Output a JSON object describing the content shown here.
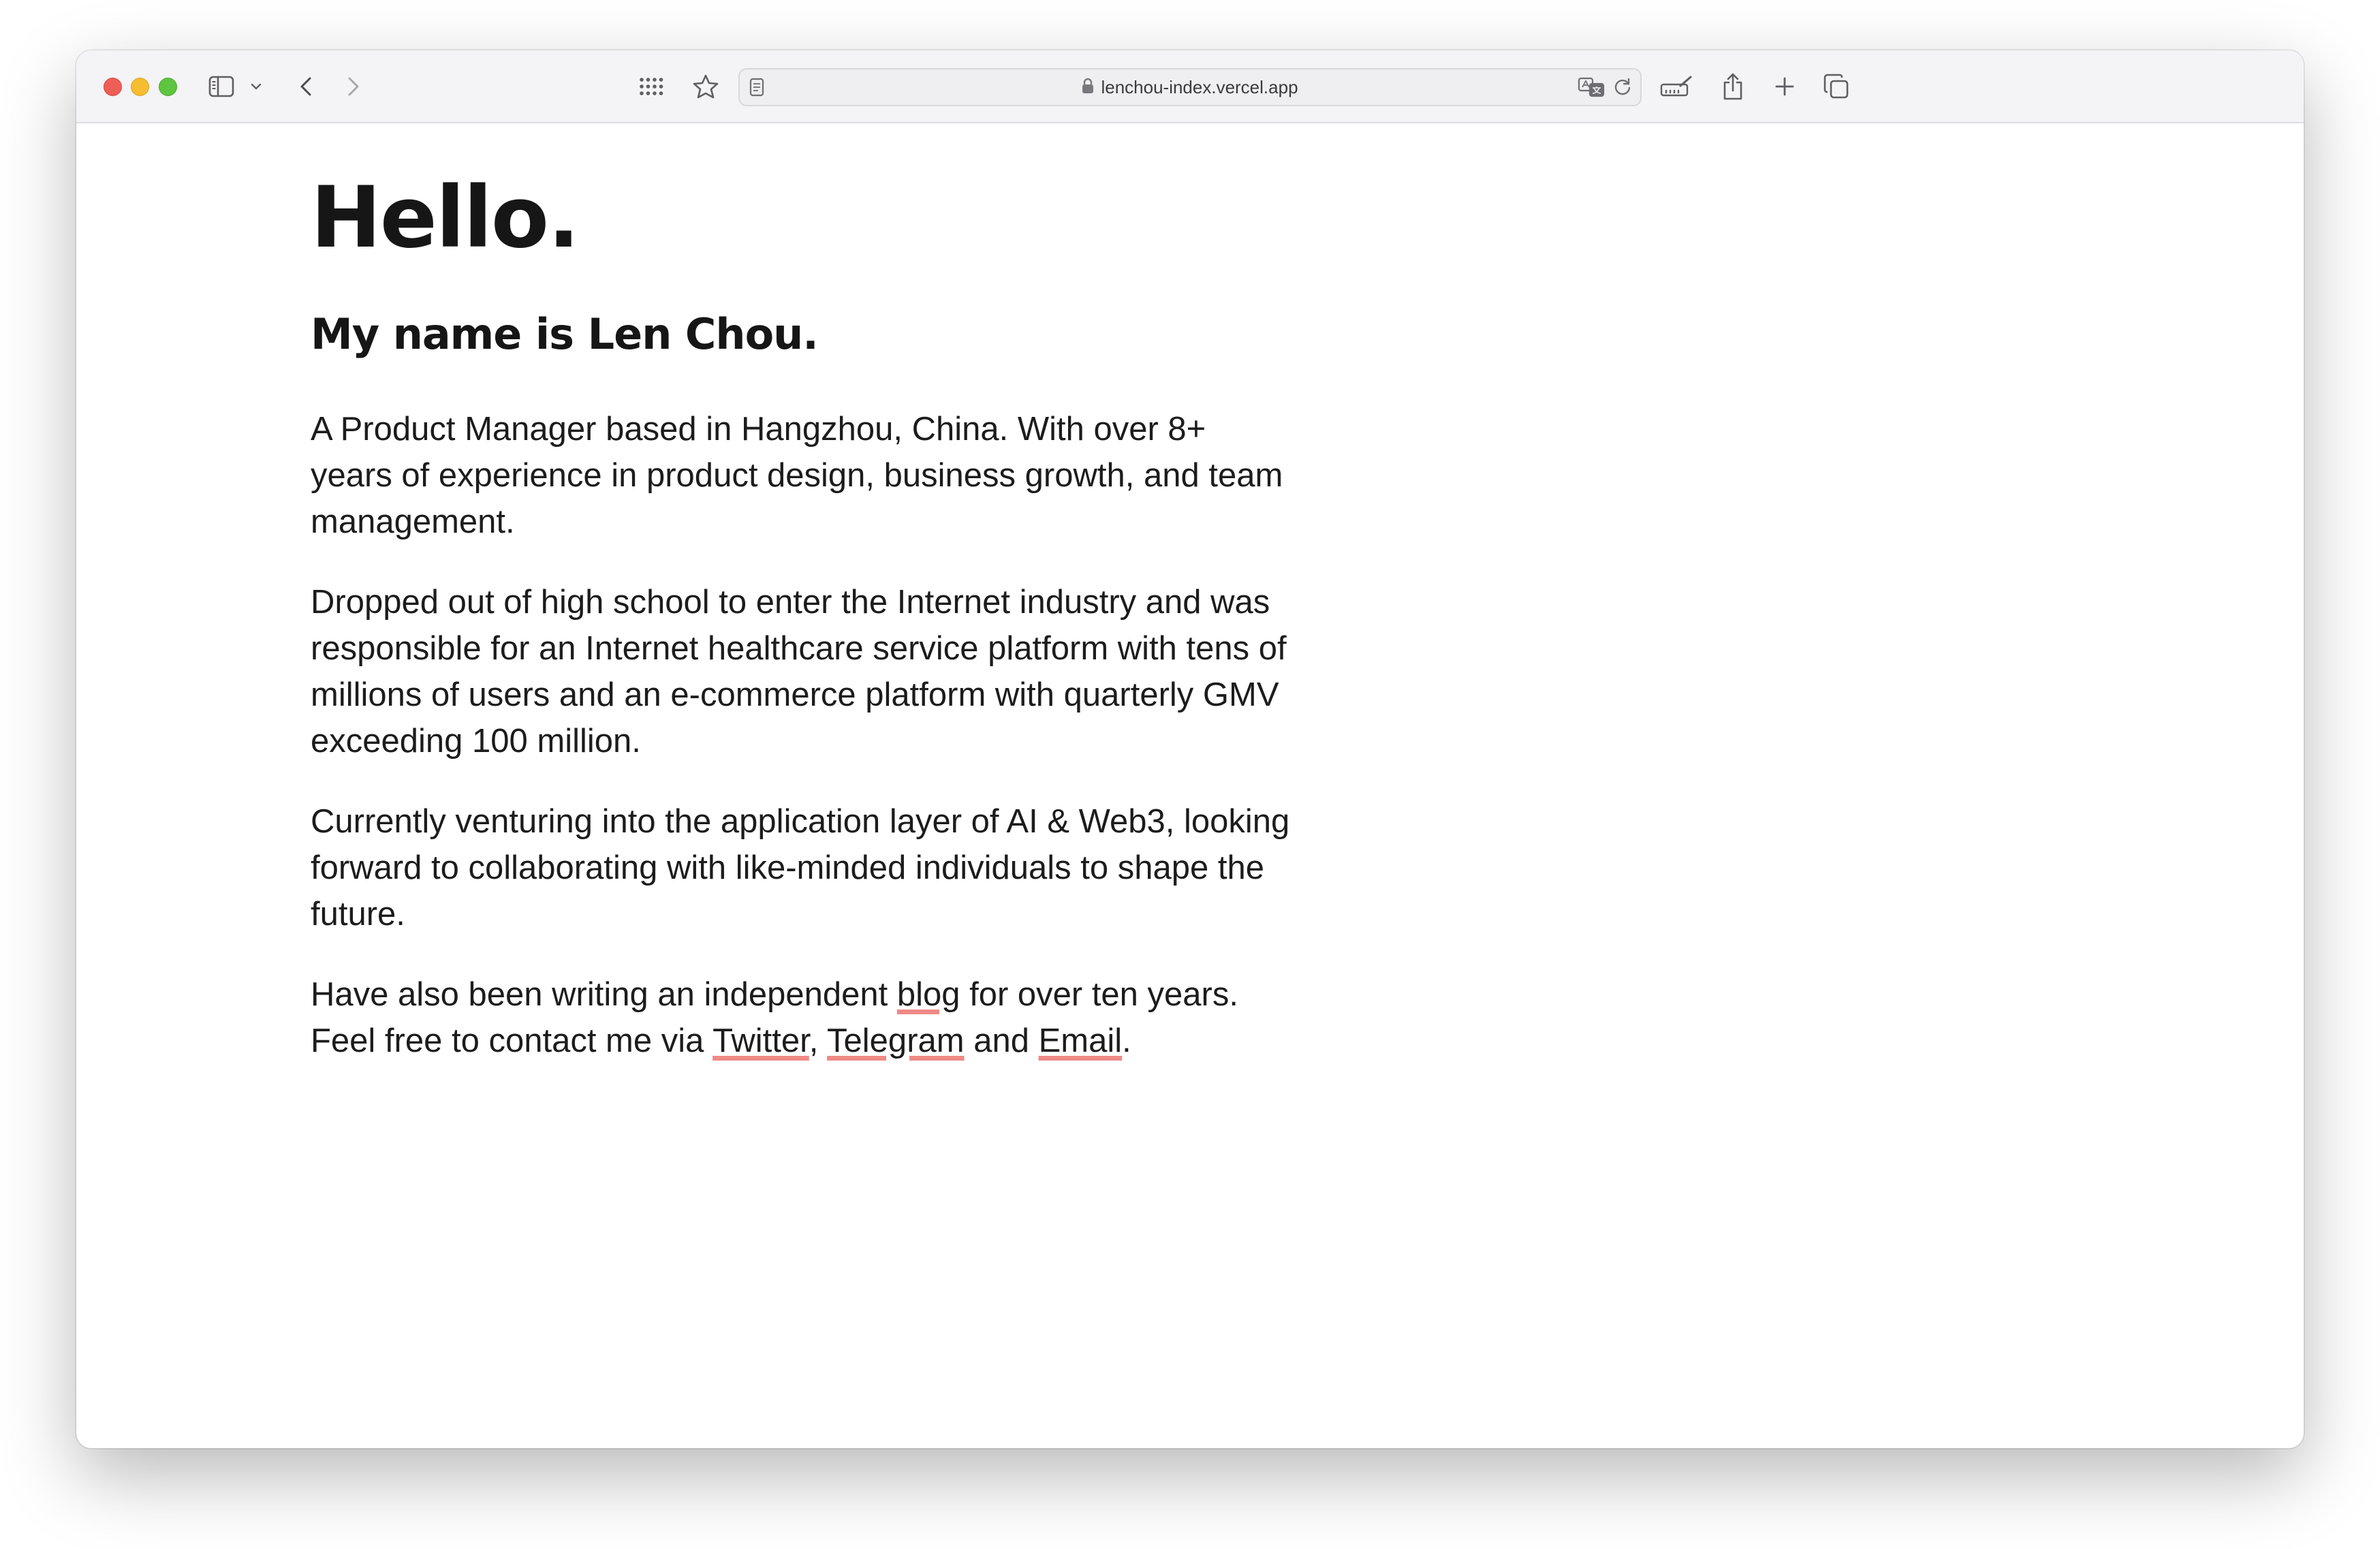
{
  "browser": {
    "url": "lenchou-index.vercel.app",
    "icons": {
      "sidebar": "sidebar-icon",
      "sidebar_menu": "chevron-down-icon",
      "back": "chevron-left-icon",
      "forward": "chevron-right-icon",
      "grid": "grid-icon",
      "bookmark": "star-icon",
      "reader": "page-icon",
      "lock": "lock-icon",
      "translate": "translate-icon",
      "reload": "reload-icon",
      "hide_distracting": "ruler-pencil-icon",
      "share": "share-icon",
      "new_tab": "plus-icon",
      "tab_overview": "tabs-icon"
    },
    "colors": {
      "close": "#ee5f57",
      "minimize": "#f5bd2f",
      "maximize": "#5fc43f",
      "link_underline": "#f08a86"
    }
  },
  "page": {
    "greeting": "Hello.",
    "name": "My name is Len Chou.",
    "p1": "A Product Manager based in Hangzhou, China. With over 8+ years of experience in product design, business growth, and team management.",
    "p2": "Dropped out of high school to enter the Internet industry and was responsible for an Internet healthcare service platform with tens of millions of users and an e-commerce platform with quarterly GMV exceeding 100 million.",
    "p3": "Currently venturing into the application layer of AI & Web3, looking forward to collaborating with like-minded individuals to shape the future.",
    "p4": {
      "before_blog": "Have also been writing an independent ",
      "blog": "blog",
      "middle": " for over ten years. Feel free to contact me via ",
      "twitter": "Twitter",
      "comma": ", ",
      "telegram": "Telegram",
      "and": " and ",
      "email": "Email",
      "period": "."
    }
  }
}
